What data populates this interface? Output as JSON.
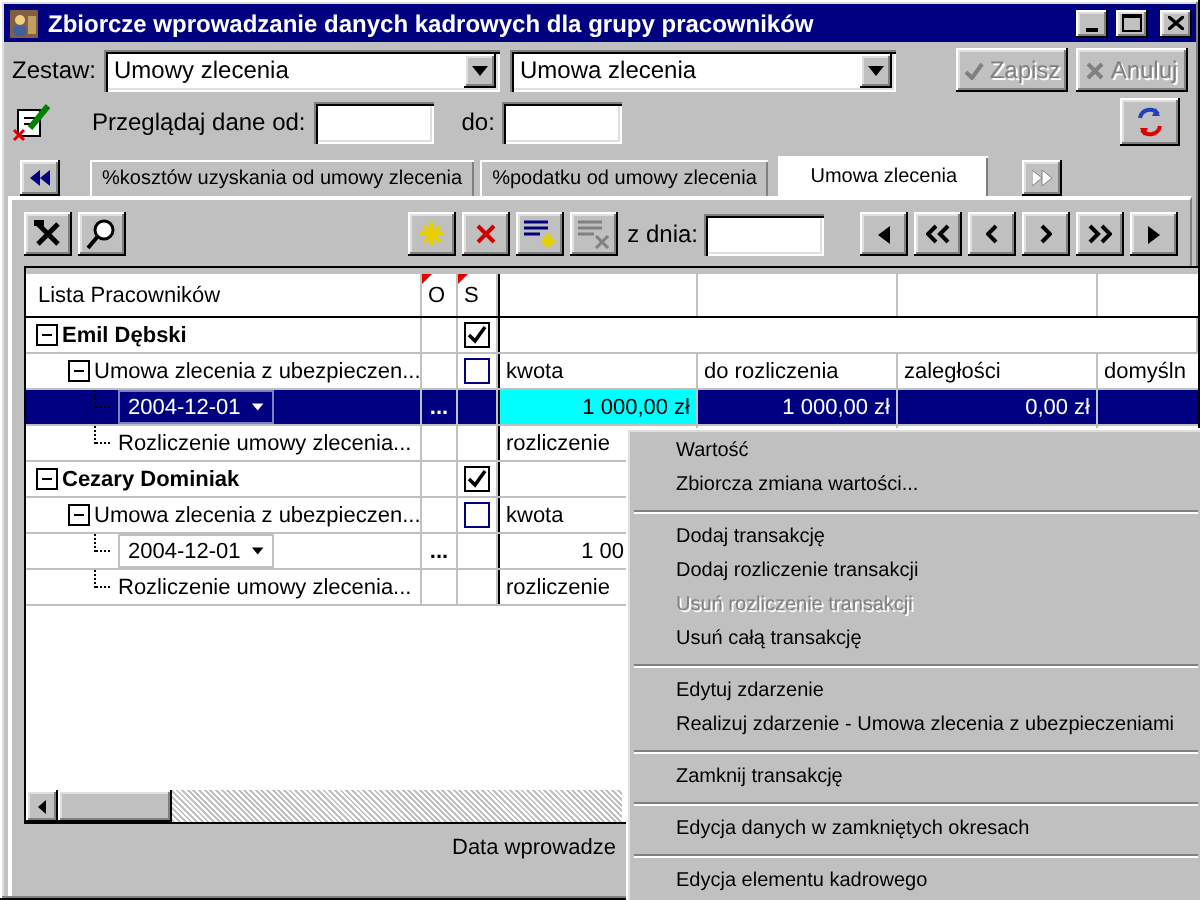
{
  "window": {
    "title": "Zbiorcze wprowadzanie danych kadrowych dla grupy pracowników"
  },
  "set_row": {
    "label": "Zestaw:",
    "combo_1": "Umowy zlecenia",
    "combo_2": "Umowa zlecenia",
    "buttons": [
      {
        "kind": "save",
        "label": "Zapisz",
        "disabled": true
      },
      {
        "kind": "cancel",
        "label": "Anuluj",
        "disabled": true
      }
    ]
  },
  "date_row": {
    "label_from": "Przeglądaj dane od:",
    "label_to": "do:"
  },
  "tabs": {
    "prev_disabled": false,
    "next_disabled": true,
    "items": [
      {
        "label": "%kosztów uzyskania od umowy zlecenia",
        "selected": false
      },
      {
        "label": "%podatku od umowy zlecenia",
        "selected": false
      },
      {
        "label": "Umowa zlecenia",
        "selected": true
      }
    ]
  },
  "toolbar": {
    "date_label": "z dnia:",
    "tools": [
      {
        "kind": "new",
        "disabled": false
      },
      {
        "kind": "delete",
        "disabled": false
      },
      {
        "kind": "add_list",
        "disabled": false
      },
      {
        "kind": "remove_list",
        "disabled": true
      }
    ]
  },
  "grid": {
    "columns": {
      "tree": "Lista Pracowników",
      "o": "O",
      "s": "S"
    },
    "employees": [
      {
        "name": "Emil Dębski",
        "expanded": true,
        "checked": true,
        "children": [
          {
            "label": "Umowa zlecenia z ubezpieczen...",
            "expanded": true,
            "checked": false,
            "cells": [
              {
                "text": "kwota"
              },
              {
                "text": "do rozliczenia"
              },
              {
                "text": "zaległości"
              },
              {
                "text": "domyśln"
              }
            ],
            "children": [
              {
                "kind": "date",
                "label": "2004-12-01",
                "button": "...",
                "selected": true,
                "cells": [
                  {
                    "text": "1 000,00 zł",
                    "focused": true
                  },
                  {
                    "text": "1 000,00 zł",
                    "focused": false
                  },
                  {
                    "text": "0,00 zł",
                    "focused": false
                  }
                ]
              },
              {
                "kind": "settlement",
                "label": "Rozliczenie umowy zlecenia...",
                "selected": false,
                "cells": [
                  {
                    "text": "rozliczenie"
                  }
                ]
              }
            ]
          }
        ]
      },
      {
        "name": "Cezary Dominiak",
        "expanded": true,
        "checked": true,
        "children": [
          {
            "label": "Umowa zlecenia z ubezpieczen...",
            "expanded": true,
            "checked": false,
            "cells": [
              {
                "text": "kwota"
              }
            ],
            "children": [
              {
                "kind": "date",
                "label": "2004-12-01",
                "button": "...",
                "selected": false,
                "cells": [
                  {
                    "text": "1 00",
                    "focused": false,
                    "cut": true
                  }
                ]
              },
              {
                "kind": "settlement",
                "label": "Rozliczenie umowy zlecenia...",
                "selected": false,
                "cells": [
                  {
                    "text": "rozliczenie"
                  }
                ]
              }
            ]
          }
        ]
      }
    ]
  },
  "status_bar": "Data wprowadze",
  "context_menu": [
    {
      "kind": "item",
      "label": "Wartość",
      "disabled": false
    },
    {
      "kind": "item",
      "label": "Zbiorcza zmiana wartości...",
      "disabled": false
    },
    {
      "kind": "separator"
    },
    {
      "kind": "item",
      "label": "Dodaj transakcję",
      "disabled": false
    },
    {
      "kind": "item",
      "label": "Dodaj rozliczenie transakcji",
      "disabled": false
    },
    {
      "kind": "item",
      "label": "Usuń rozliczenie transakcji",
      "disabled": true
    },
    {
      "kind": "item",
      "label": "Usuń całą transakcję",
      "disabled": false
    },
    {
      "kind": "separator"
    },
    {
      "kind": "item",
      "label": "Edytuj zdarzenie",
      "disabled": false
    },
    {
      "kind": "item",
      "label": "Realizuj zdarzenie - Umowa zlecenia z ubezpieczeniami",
      "disabled": false
    },
    {
      "kind": "separator"
    },
    {
      "kind": "item",
      "label": "Zamknij transakcję",
      "disabled": false
    },
    {
      "kind": "separator"
    },
    {
      "kind": "item",
      "label": "Edycja danych w zamkniętych okresach",
      "disabled": false
    },
    {
      "kind": "separator"
    },
    {
      "kind": "item",
      "label": "Edycja elementu kadrowego",
      "disabled": false
    }
  ]
}
